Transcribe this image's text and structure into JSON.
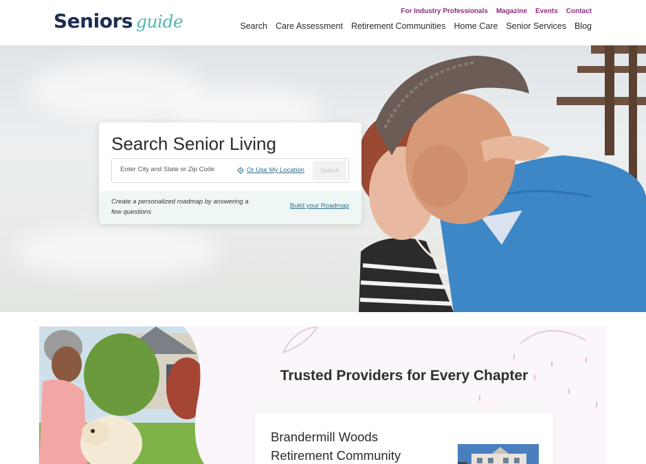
{
  "brand": {
    "name_main": "Seniors",
    "name_sub": "guide"
  },
  "utility_nav": [
    {
      "label": "For Industry Professionals"
    },
    {
      "label": "Magazine"
    },
    {
      "label": "Events"
    },
    {
      "label": "Contact"
    }
  ],
  "main_nav": [
    {
      "label": "Search"
    },
    {
      "label": "Care Assessment"
    },
    {
      "label": "Retirement Communities"
    },
    {
      "label": "Home Care"
    },
    {
      "label": "Senior Services"
    },
    {
      "label": "Blog"
    }
  ],
  "hero": {
    "search_title": "Search Senior Living",
    "search_placeholder": "Enter City and State or Zip Code",
    "location_link": "Or Use My Location",
    "search_button": "Search",
    "roadmap_text": "Create a personalized roadmap by answering a few questions",
    "roadmap_link": "Build your Roadmap"
  },
  "providers_section": {
    "title": "Trusted Providers for Every Chapter",
    "featured_provider": "Brandermill Woods Retirement Community"
  },
  "colors": {
    "brand_navy": "#1f2d52",
    "brand_teal": "#4fb7ad",
    "utility_purple": "#8a2f7c",
    "link_blue": "#2e6f8c"
  },
  "icons": {
    "location": "location-target-icon"
  }
}
